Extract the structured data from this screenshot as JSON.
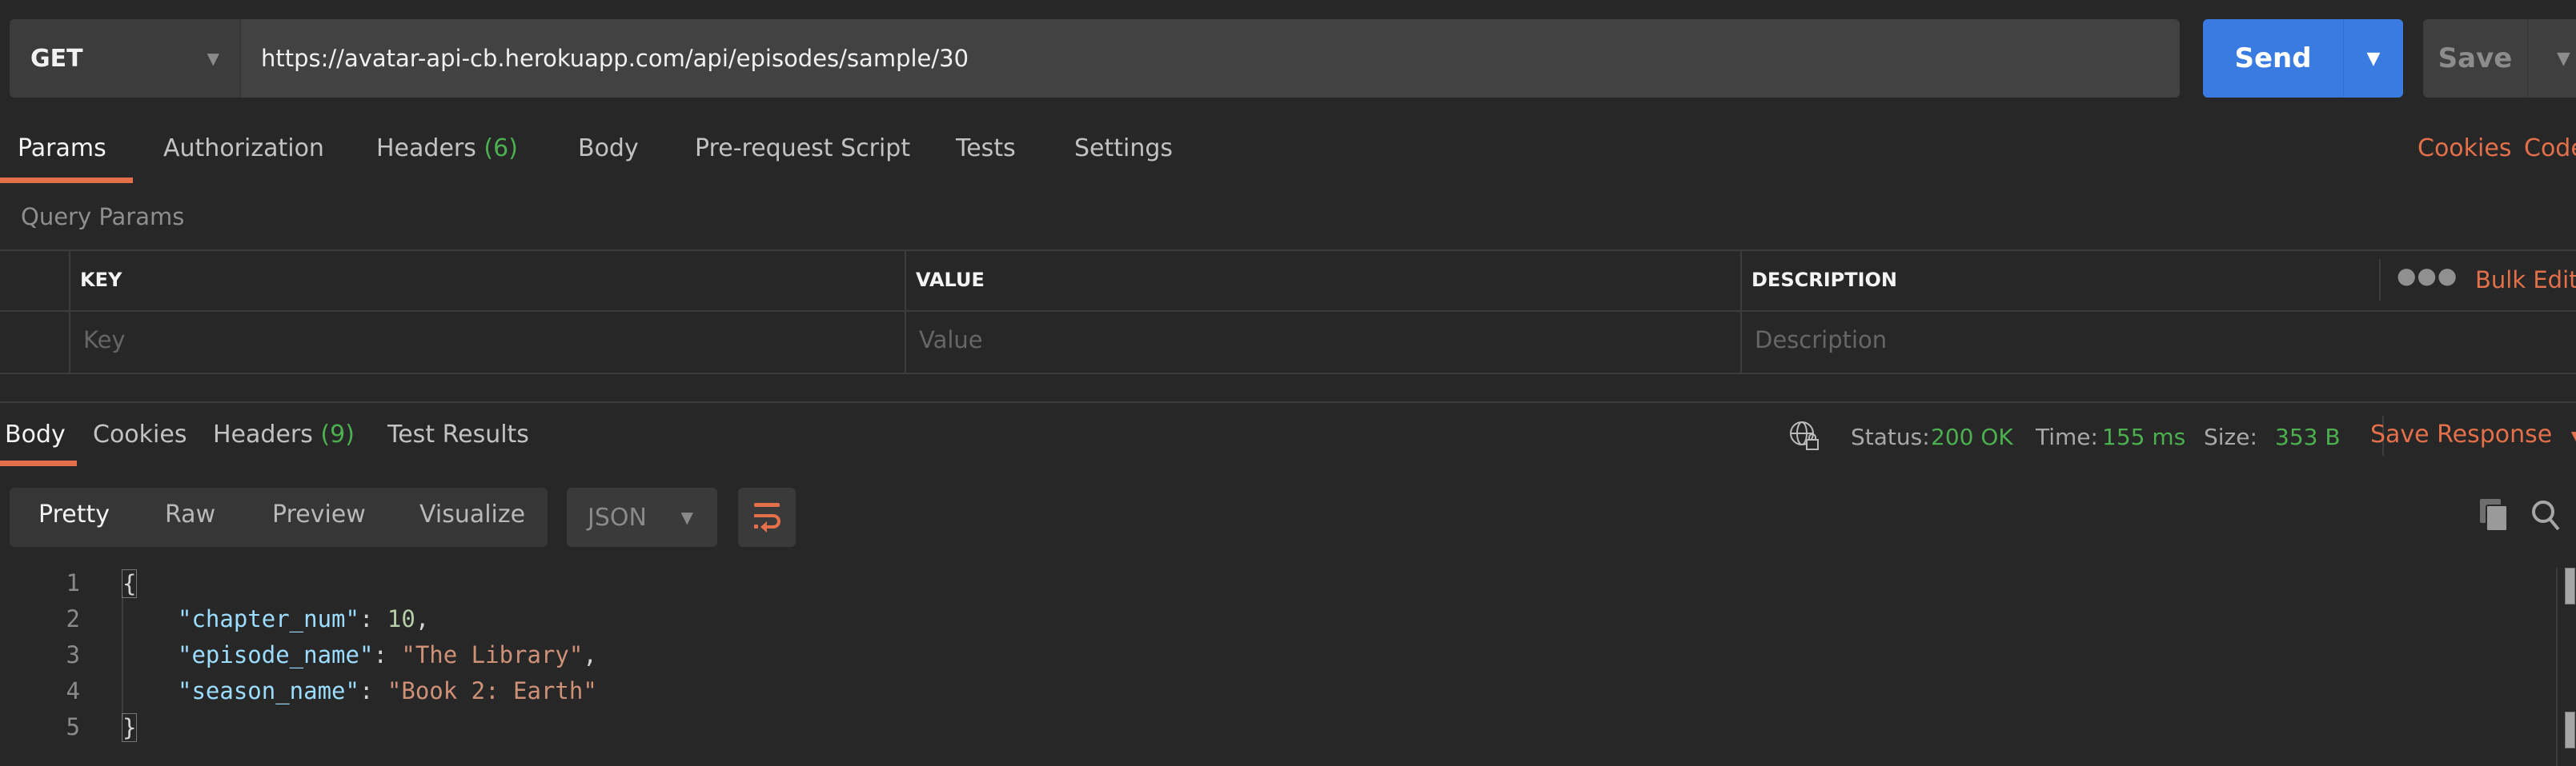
{
  "request": {
    "method": "GET",
    "url": "https://avatar-api-cb.herokuapp.com/api/episodes/sample/30",
    "send_label": "Send",
    "save_label": "Save"
  },
  "request_tabs": [
    {
      "label": "Params",
      "active": true
    },
    {
      "label": "Authorization"
    },
    {
      "label": "Headers",
      "count": "(6)"
    },
    {
      "label": "Body"
    },
    {
      "label": "Pre-request Script"
    },
    {
      "label": "Tests"
    },
    {
      "label": "Settings"
    }
  ],
  "request_links": {
    "cookies": "Cookies",
    "code": "Code"
  },
  "query_params": {
    "title": "Query Params",
    "columns": [
      "KEY",
      "VALUE",
      "DESCRIPTION"
    ],
    "placeholders": {
      "key": "Key",
      "value": "Value",
      "description": "Description"
    },
    "more_icon": "ellipsis-icon",
    "bulk_edit": "Bulk Edit"
  },
  "response_tabs": [
    {
      "label": "Body",
      "active": true
    },
    {
      "label": "Cookies"
    },
    {
      "label": "Headers",
      "count": "(9)"
    },
    {
      "label": "Test Results"
    }
  ],
  "response_meta": {
    "status_label": "Status:",
    "status_value": "200 OK",
    "time_label": "Time:",
    "time_value": "155 ms",
    "size_label": "Size:",
    "size_value": "353 B",
    "save_response": "Save Response"
  },
  "view_modes": [
    {
      "label": "Pretty",
      "active": true
    },
    {
      "label": "Raw"
    },
    {
      "label": "Preview"
    },
    {
      "label": "Visualize"
    }
  ],
  "format": "JSON",
  "code": {
    "line_numbers": [
      "1",
      "2",
      "3",
      "4",
      "5"
    ],
    "open_brace": "{",
    "close_brace": "}",
    "entries": [
      {
        "key": "\"chapter_num\"",
        "value": "10",
        "trail": ","
      },
      {
        "key": "\"episode_name\"",
        "value": "\"The Library\"",
        "trail": ","
      },
      {
        "key": "\"season_name\"",
        "value": "\"Book 2: Earth\"",
        "trail": ""
      }
    ]
  },
  "colors": {
    "accent": "#e3704a",
    "send": "#3a7be2",
    "success": "#4caf50",
    "background": "#272727"
  }
}
